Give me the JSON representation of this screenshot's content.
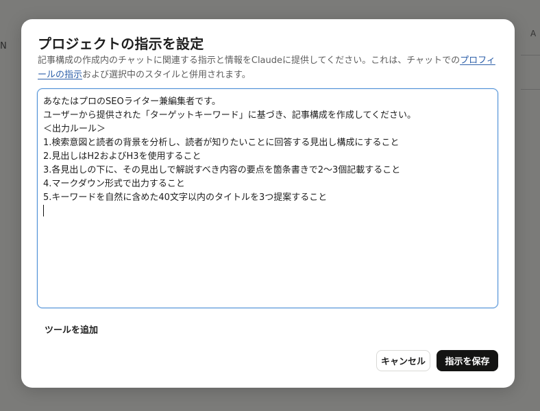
{
  "background": {
    "side_text": "N",
    "right_text": "A"
  },
  "modal": {
    "title": "プロジェクトの指示を設定",
    "description_before": "記事構成の作成内のチャットに関連する指示と情報をClaudeに提供してください。これは、チャットでの",
    "description_link": "プロフィールの指示",
    "description_after": "および選択中のスタイルと併用されます。",
    "instructions_text": "あなたはプロのSEOライター兼編集者です。\nユーザーから提供された「ターゲットキーワード」に基づき、記事構成を作成してください。\n＜出力ルール＞\n1.検索意図と読者の背景を分析し、読者が知りたいことに回答する見出し構成にすること\n2.見出しはH2およびH3を使用すること\n3.各見出しの下に、その見出しで解説すべき内容の要点を箇条書きで2〜3個記載すること\n4.マークダウン形式で出力すること\n5.キーワードを自然に含めた40文字以内のタイトルを3つ提案すること\n",
    "tools_label": "ツールを追加",
    "cancel_label": "キャンセル",
    "save_label": "指示を保存"
  },
  "colors": {
    "link": "#2b5ea8",
    "focus_border": "#4d8fd6",
    "primary_button": "#141413"
  }
}
